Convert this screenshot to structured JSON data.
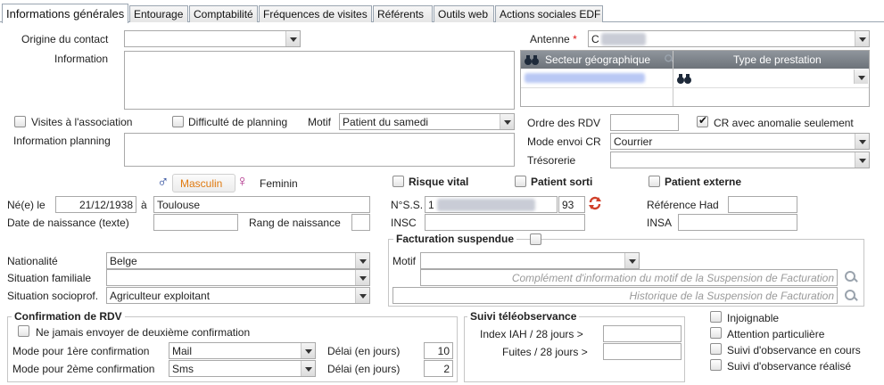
{
  "tabs": [
    "Informations générales",
    "Entourage",
    "Comptabilité",
    "Fréquences de visites",
    "Référents",
    "Outils web",
    "Actions sociales EDF"
  ],
  "contact": {
    "origine_label": "Origine du contact",
    "origine_value": "",
    "information_label": "Information",
    "visites_label": "Visites à l'association",
    "difficulte_label": "Difficulté de planning",
    "motif_label": "Motif",
    "motif_value": "Patient du samedi",
    "info_planning_label": "Information planning"
  },
  "antenne": {
    "label": "Antenne",
    "required_mark": "*",
    "value": "C",
    "table_headers": [
      "Secteur géographique",
      "Type de prestation"
    ],
    "table_row_value": "",
    "ordre_label": "Ordre des RDV",
    "cr_label": "CR avec anomalie seulement",
    "cr_checked": true,
    "mode_envoi_label": "Mode envoi CR",
    "mode_envoi_value": "Courrier",
    "tresorerie_label": "Trésorerie",
    "tresorerie_value": ""
  },
  "gender": {
    "masculin_symbol": "♂",
    "masculin": "Masculin",
    "feminin_symbol": "♀",
    "feminin": "Feminin",
    "colors": {
      "masculin_accent": "#e07a10",
      "masculin_symbol": "#2b4a9a",
      "feminin_symbol": "#b0308a"
    }
  },
  "flags": {
    "risque_vital": "Risque vital",
    "patient_sorti": "Patient sorti",
    "patient_externe": "Patient externe"
  },
  "identity": {
    "ne_le_label": "Né(e) le",
    "ne_le_value": "21/12/1938",
    "a_label": "à",
    "lieu_value": "Toulouse",
    "date_texte_label": "Date de naissance (texte)",
    "rang_label": "Rang de naissance",
    "nss_label": "N°S.S.",
    "nss_prefix": "1",
    "nss_key": "93",
    "insc_label": "INSC",
    "ref_had_label": "Référence Had",
    "insa_label": "INSA"
  },
  "social": {
    "nationalite_label": "Nationalité",
    "nationalite_value": "Belge",
    "situation_familiale_label": "Situation familiale",
    "situation_familiale_value": "",
    "situation_socioprof_label": "Situation socioprof.",
    "situation_socioprof_value": "Agriculteur exploitant"
  },
  "facturation": {
    "legend": "Facturation suspendue",
    "motif_label": "Motif",
    "motif_value": "",
    "complement_placeholder": "Complément d'information du motif de la Suspension de Facturation",
    "historique_placeholder": "Historique de la Suspension de Facturation"
  },
  "confirmation": {
    "legend": "Confirmation de RDV",
    "never_label": "Ne jamais envoyer de deuxième confirmation",
    "mode1_label": "Mode pour 1ère confirmation",
    "mode1_value": "Mail",
    "delai1_label": "Délai (en jours)",
    "delai1_value": "10",
    "mode2_label": "Mode pour 2ème confirmation",
    "mode2_value": "Sms",
    "delai2_label": "Délai (en jours)",
    "delai2_value": "2"
  },
  "teleobservance": {
    "legend": "Suivi téléobservance",
    "index_label": "Index IAH / 28 jours >",
    "index_value": "",
    "fuites_label": "Fuites / 28 jours >",
    "fuites_value": ""
  },
  "status_checks": [
    "Injoignable",
    "Attention particulière",
    "Suivi d'observance en cours",
    "Suivi d'observance réalisé"
  ]
}
